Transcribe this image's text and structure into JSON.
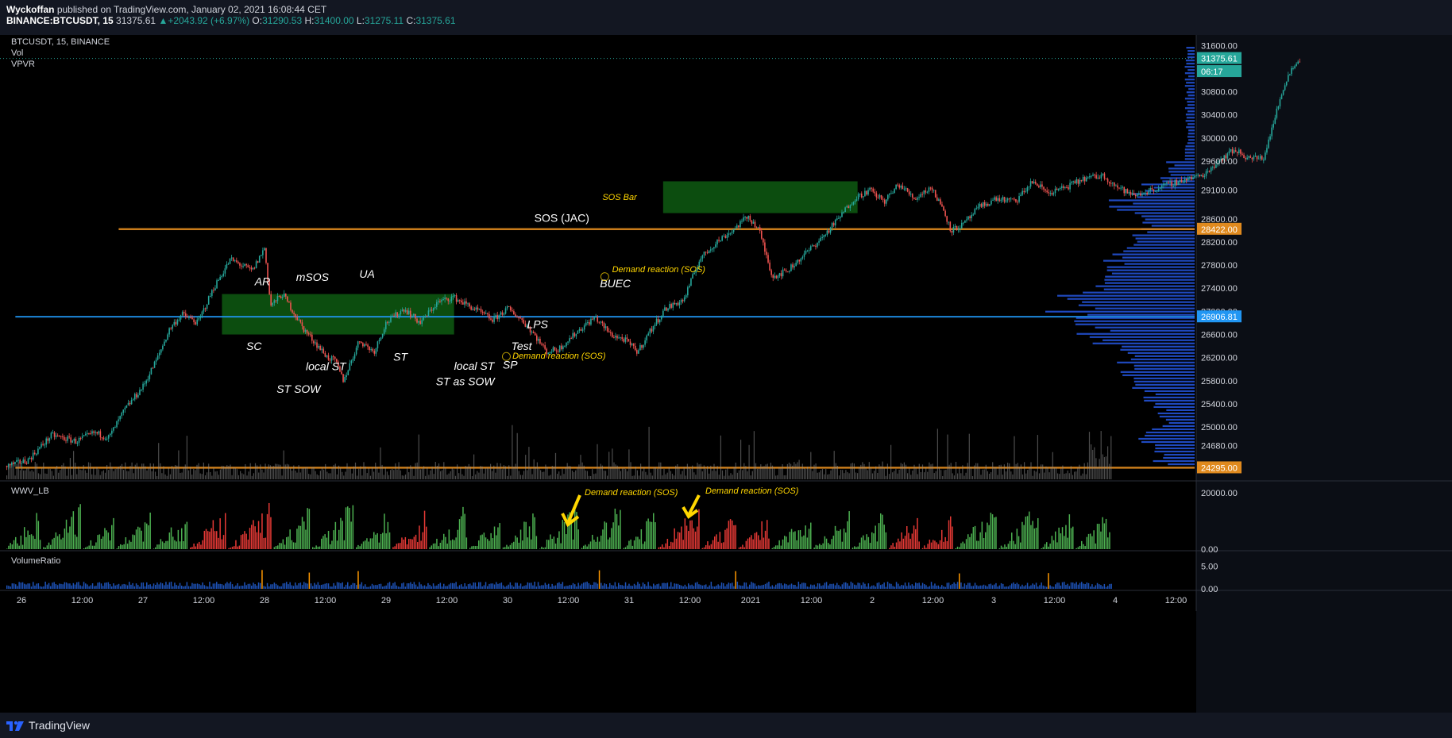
{
  "header": {
    "author": "Wyckoffan",
    "published_text": "published on TradingView.com, January 02, 2021 16:08:44 CET",
    "symbol": "BINANCE:BTCUSDT, 15",
    "last": "31375.61",
    "change": "+2043.92 (+6.97%)",
    "o_label": "O:",
    "o": "31290.53",
    "h_label": "H:",
    "h": "31400.00",
    "l_label": "L:",
    "l": "31275.11",
    "c_label": "C:",
    "c": "31375.61"
  },
  "legend": {
    "symbol": "BTCUSDT, 15, BINANCE",
    "vol": "Vol",
    "vpvr": "VPVR",
    "wwv": "WWV_LB",
    "volratio": "VolumeRatio"
  },
  "footer": {
    "brand": "TradingView"
  },
  "colors": {
    "bull": "#26a69a",
    "bear": "#ef5350",
    "zone": "#0e5a12",
    "level_orange": "#e08a1e",
    "level_blue": "#2196f3",
    "annot_yellow": "#ffd600",
    "wwv_green": "#4caf50",
    "wwv_red": "#e53935",
    "vp_blue": "#2962ff"
  },
  "chart_data": {
    "type": "candlestick",
    "title": "BTCUSDT, 15, BINANCE",
    "ylim": [
      24150,
      31700
    ],
    "x_tick_labels": [
      "26",
      "12:00",
      "27",
      "12:00",
      "28",
      "12:00",
      "29",
      "12:00",
      "30",
      "12:00",
      "31",
      "12:00",
      "2021",
      "12:00",
      "2",
      "12:00",
      "3",
      "12:00",
      "4",
      "12:00"
    ],
    "y_tick_labels": [
      "31600.00",
      "31200.00",
      "30800.00",
      "30400.00",
      "30000.00",
      "29600.00",
      "29100.00",
      "28600.00",
      "28200.00",
      "27800.00",
      "27400.00",
      "27000.00",
      "26600.00",
      "26200.00",
      "25800.00",
      "25400.00",
      "25000.00",
      "24680.00"
    ],
    "y_tick_values": [
      31600,
      31200,
      30800,
      30400,
      30000,
      29600,
      29100,
      28600,
      28200,
      27800,
      27400,
      27000,
      26600,
      26200,
      25800,
      25400,
      25000,
      24680
    ],
    "price_badges": [
      {
        "label": "31375.61",
        "value": 31375.61,
        "color": "#26a69a"
      },
      {
        "label": "06:17",
        "value": 31150,
        "color": "#26a69a"
      },
      {
        "label": "28422.00",
        "value": 28422,
        "color": "#e08a1e"
      },
      {
        "label": "26906.81",
        "value": 26906.81,
        "color": "#2196f3"
      },
      {
        "label": "24295.00",
        "value": 24295,
        "color": "#e08a1e"
      }
    ],
    "levels": [
      {
        "name": "resistance",
        "value": 28422,
        "color": "#e08a1e",
        "start_day": 0.8
      },
      {
        "name": "poc",
        "value": 26906.81,
        "color": "#2196f3",
        "start_day": -0.05
      },
      {
        "name": "support",
        "value": 24295,
        "color": "#e08a1e",
        "start_day": -0.05
      }
    ],
    "zones": [
      {
        "name": "trading-range",
        "day_start": 1.65,
        "day_end": 3.56,
        "price_top": 27300,
        "price_bottom": 26600
      },
      {
        "name": "reaccumulation",
        "day_start": 5.28,
        "day_end": 6.88,
        "price_top": 29250,
        "price_bottom": 28700
      }
    ],
    "price_path": [
      [
        -0.12,
        24330
      ],
      [
        0.05,
        24420
      ],
      [
        0.25,
        24860
      ],
      [
        0.45,
        24750
      ],
      [
        0.6,
        24900
      ],
      [
        0.72,
        24820
      ],
      [
        0.85,
        25300
      ],
      [
        1.0,
        25700
      ],
      [
        1.12,
        26200
      ],
      [
        1.22,
        26700
      ],
      [
        1.32,
        26950
      ],
      [
        1.45,
        26800
      ],
      [
        1.58,
        27400
      ],
      [
        1.72,
        27900
      ],
      [
        1.9,
        27700
      ],
      [
        2.0,
        28100
      ],
      [
        2.05,
        27100
      ],
      [
        2.15,
        27300
      ],
      [
        2.32,
        26700
      ],
      [
        2.52,
        26200
      ],
      [
        2.58,
        26150
      ],
      [
        2.65,
        25800
      ],
      [
        2.78,
        26500
      ],
      [
        2.9,
        26300
      ],
      [
        3.0,
        26800
      ],
      [
        3.15,
        27050
      ],
      [
        3.28,
        26800
      ],
      [
        3.42,
        27150
      ],
      [
        3.55,
        27250
      ],
      [
        3.72,
        27050
      ],
      [
        3.88,
        26850
      ],
      [
        4.0,
        27050
      ],
      [
        4.12,
        26850
      ],
      [
        4.22,
        26600
      ],
      [
        4.32,
        26300
      ],
      [
        4.42,
        26350
      ],
      [
        4.6,
        26700
      ],
      [
        4.72,
        26900
      ],
      [
        4.85,
        26600
      ],
      [
        4.97,
        26500
      ],
      [
        5.07,
        26300
      ],
      [
        5.17,
        26650
      ],
      [
        5.3,
        27050
      ],
      [
        5.45,
        27200
      ],
      [
        5.58,
        27900
      ],
      [
        5.72,
        28200
      ],
      [
        5.85,
        28400
      ],
      [
        5.98,
        28650
      ],
      [
        6.07,
        28400
      ],
      [
        6.18,
        27600
      ],
      [
        6.3,
        27700
      ],
      [
        6.45,
        28000
      ],
      [
        6.6,
        28300
      ],
      [
        6.72,
        28600
      ],
      [
        6.85,
        28950
      ],
      [
        6.98,
        29100
      ],
      [
        7.1,
        28900
      ],
      [
        7.22,
        29200
      ],
      [
        7.35,
        28950
      ],
      [
        7.48,
        29150
      ],
      [
        7.58,
        28800
      ],
      [
        7.65,
        28400
      ],
      [
        7.75,
        28500
      ],
      [
        7.88,
        28800
      ],
      [
        8.02,
        28950
      ],
      [
        8.18,
        28900
      ],
      [
        8.32,
        29250
      ],
      [
        8.45,
        29050
      ],
      [
        8.6,
        29150
      ],
      [
        8.75,
        29300
      ],
      [
        8.9,
        29350
      ],
      [
        9.02,
        29150
      ],
      [
        9.15,
        29000
      ],
      [
        9.3,
        29100
      ],
      [
        9.45,
        29200
      ],
      [
        9.6,
        29300
      ],
      [
        9.72,
        29350
      ],
      [
        9.85,
        29600
      ],
      [
        9.98,
        29800
      ],
      [
        10.1,
        29650
      ],
      [
        10.22,
        29650
      ],
      [
        10.32,
        30400
      ],
      [
        10.42,
        31100
      ],
      [
        10.52,
        31375
      ]
    ],
    "annotations": [
      {
        "text": "AR",
        "day": 1.92,
        "price": 27450,
        "italic": true
      },
      {
        "text": "mSOS",
        "day": 2.26,
        "price": 27530,
        "italic": true
      },
      {
        "text": "UA",
        "day": 2.78,
        "price": 27580,
        "italic": true
      },
      {
        "text": "SC",
        "day": 1.85,
        "price": 26330,
        "italic": true
      },
      {
        "text": "local ST",
        "day": 2.34,
        "price": 25980,
        "italic": true
      },
      {
        "text": "ST SOW",
        "day": 2.1,
        "price": 25590,
        "italic": true
      },
      {
        "text": "ST",
        "day": 3.06,
        "price": 26150,
        "italic": true
      },
      {
        "text": "local ST",
        "day": 3.56,
        "price": 25990,
        "italic": true
      },
      {
        "text": "ST as SOW",
        "day": 3.41,
        "price": 25720,
        "italic": true
      },
      {
        "text": "SP",
        "day": 3.96,
        "price": 26010,
        "italic": true
      },
      {
        "text": "Test",
        "day": 4.03,
        "price": 26330,
        "italic": true
      },
      {
        "text": "LPS",
        "day": 4.16,
        "price": 26710,
        "italic": true
      },
      {
        "text": "SOS (JAC)",
        "day": 4.22,
        "price": 28550,
        "italic": false
      },
      {
        "text": "BUEC",
        "day": 4.76,
        "price": 27420,
        "italic": true
      }
    ],
    "demand_notes": [
      {
        "text": "Demand reaction (SOS)",
        "day": 4.86,
        "price": 27680
      },
      {
        "text": "Demand reaction (SOS)",
        "day": 4.04,
        "price": 26180
      }
    ],
    "sos_bar": {
      "text": "SOS Bar",
      "day": 4.78,
      "price": 28930
    },
    "wwv_notes": [
      {
        "text": "Demand reaction (SOS)",
        "panel": "wwv"
      },
      {
        "text": "Demand reaction (SOS)",
        "panel": "wwv"
      }
    ],
    "wwv": {
      "ylim": [
        0,
        22000
      ],
      "ticks": [
        {
          "label": "20000.00",
          "value": 20000
        },
        {
          "label": "0.00",
          "value": 0
        }
      ]
    },
    "volratio": {
      "ticks": [
        {
          "label": "5.00",
          "value": 5
        },
        {
          "label": "0.00",
          "value": 0
        }
      ]
    }
  }
}
